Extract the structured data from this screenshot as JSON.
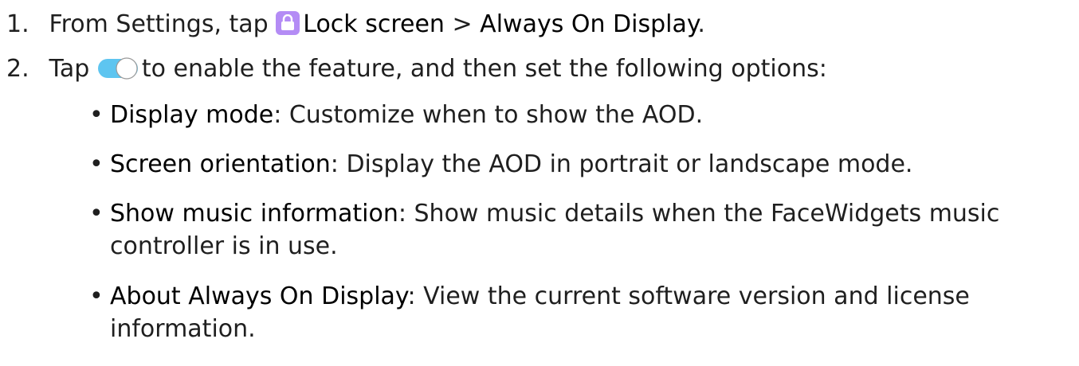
{
  "steps": [
    {
      "number": "1.",
      "prefix": "From Settings, tap",
      "target1": "Lock screen",
      "separator": ">",
      "target2": "Always On Display",
      "suffix": "."
    },
    {
      "number": "2.",
      "prefix": "Tap",
      "suffix": "to enable the feature, and then set the following options:"
    }
  ],
  "options": [
    {
      "term": "Display mode",
      "desc": ": Customize when to show the AOD."
    },
    {
      "term": "Screen orientation",
      "desc": ": Display the AOD in portrait or landscape mode."
    },
    {
      "term": "Show music information",
      "desc": ": Show music details when the FaceWidgets music controller is in use."
    },
    {
      "term": "About Always On Display",
      "desc": ": View the current software version and license information."
    }
  ],
  "bullet_char": "•",
  "icons": {
    "lock": "lock-icon",
    "toggle": "toggle-switch-icon"
  },
  "colors": {
    "lock_bg": "#b48cf5",
    "toggle_on": "#5ec5f0"
  }
}
